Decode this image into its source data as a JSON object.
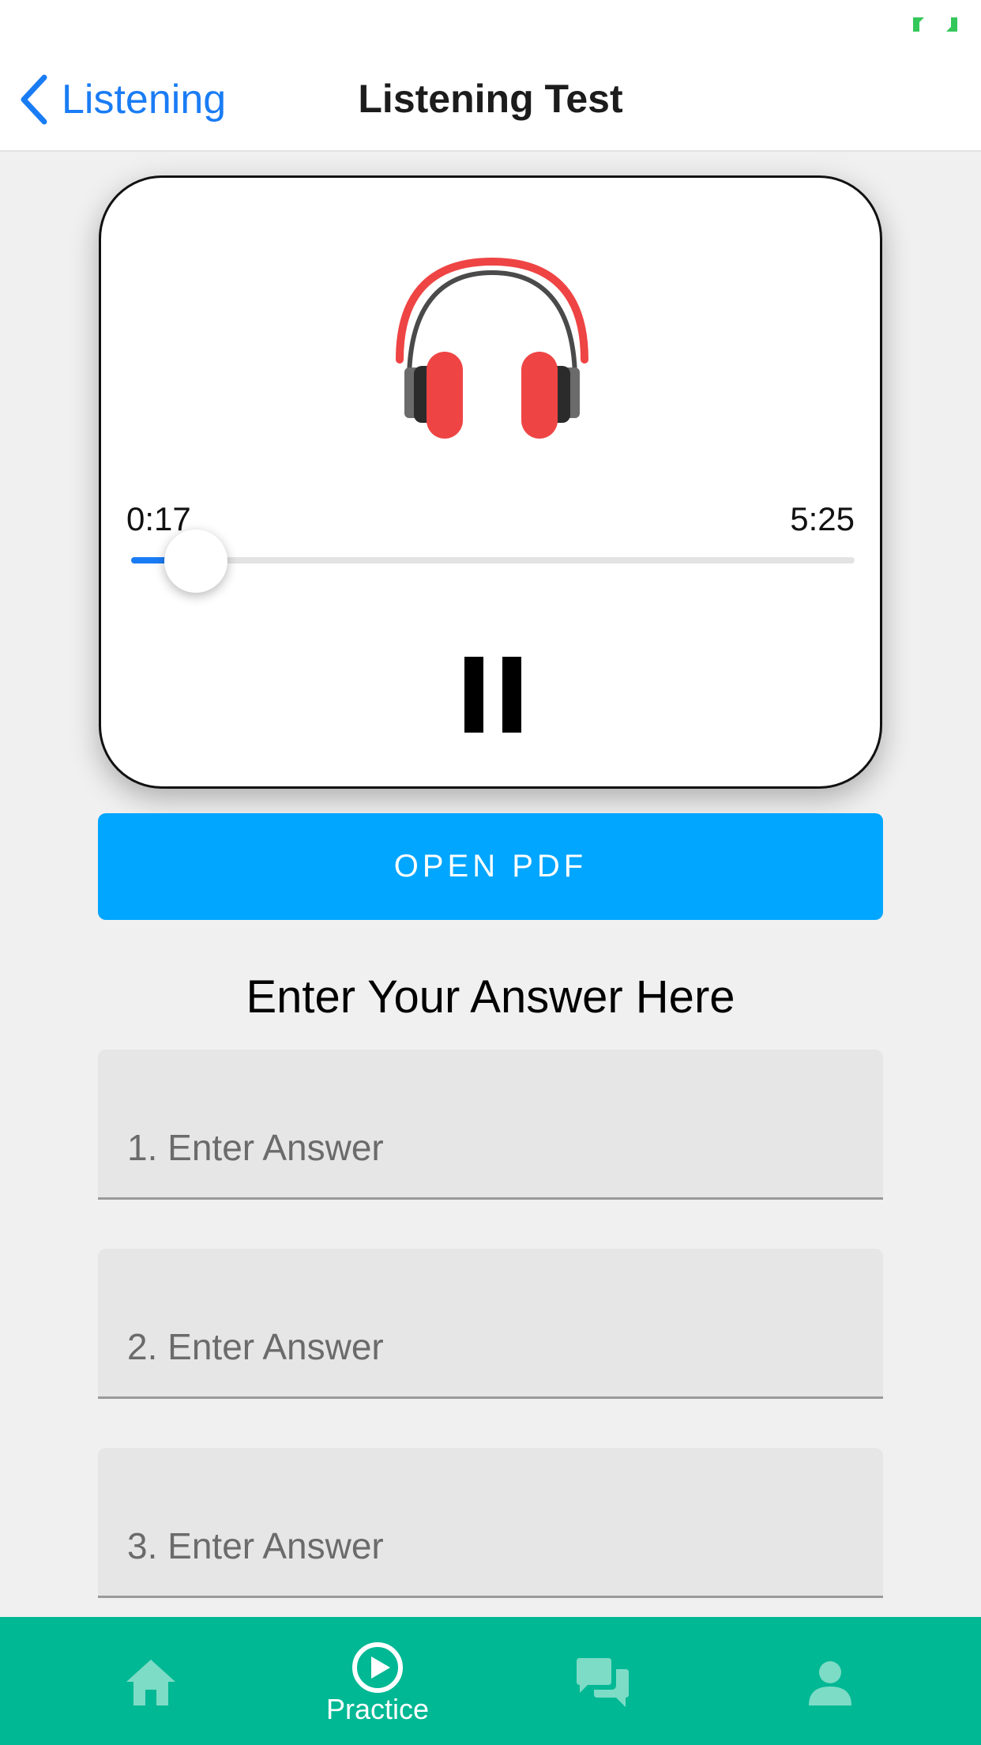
{
  "header": {
    "back_label": "Listening",
    "title": "Listening Test"
  },
  "player": {
    "current_time": "0:17",
    "total_time": "5:25",
    "progress": 0.09,
    "state": "playing"
  },
  "pdf_button": {
    "label": "OPEN PDF"
  },
  "answers": {
    "heading": "Enter Your Answer Here",
    "fields": [
      {
        "placeholder": "1. Enter Answer",
        "value": ""
      },
      {
        "placeholder": "2. Enter Answer",
        "value": ""
      },
      {
        "placeholder": "3. Enter Answer",
        "value": ""
      }
    ]
  },
  "tab_bar": {
    "tabs": [
      {
        "icon": "home-icon",
        "label": ""
      },
      {
        "icon": "play-circle-icon",
        "label": "Practice",
        "active": true
      },
      {
        "icon": "chat-icon",
        "label": ""
      },
      {
        "icon": "person-icon",
        "label": ""
      }
    ]
  },
  "colors": {
    "accent_blue": "#1a7cf5",
    "pdf_button": "#00a6ff",
    "tab_bar": "#00b894",
    "headphones_red": "#ef4444"
  }
}
